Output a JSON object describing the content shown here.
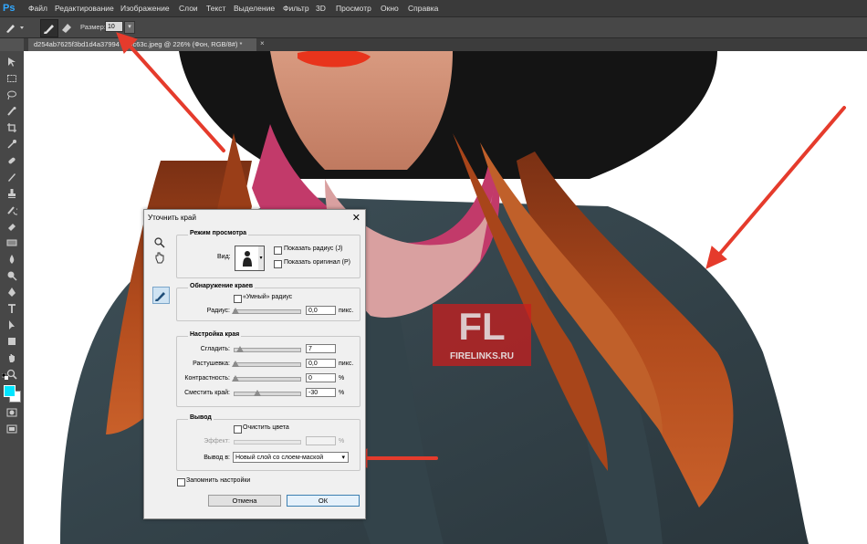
{
  "app": {
    "logo": "Ps"
  },
  "menu": [
    "Файл",
    "Редактирование",
    "Изображение",
    "Слои",
    "Текст",
    "Выделение",
    "Фильтр",
    "3D",
    "Просмотр",
    "Окно",
    "Справка"
  ],
  "options": {
    "size_label": "Размер:",
    "size_value": "10"
  },
  "document": {
    "tab_title": "d254ab7625f3bd1d4a37994 ... oc63c.jpeg @ 226% (Фон, RGB/8#) *"
  },
  "watermark": {
    "logo_text": "FL",
    "site": "FIRELINKS.RU"
  },
  "dialog": {
    "title": "Уточнить край",
    "view_mode": {
      "title": "Режим просмотра",
      "view_label": "Вид:",
      "show_radius": "Показать радиус (J)",
      "show_original": "Показать оригинал (P)"
    },
    "edge_detection": {
      "title": "Обнаружение краев",
      "smart_radius": "«Умный» радиус",
      "radius_label": "Радиус:",
      "radius_value": "0,0",
      "radius_unit": "пикс."
    },
    "adjust_edge": {
      "title": "Настройка края",
      "smooth_label": "Сгладить:",
      "smooth_value": "7",
      "feather_label": "Растушевка:",
      "feather_value": "0,0",
      "feather_unit": "пикс.",
      "contrast_label": "Контрастность:",
      "contrast_value": "0",
      "contrast_unit": "%",
      "shift_label": "Сместить край:",
      "shift_value": "-30",
      "shift_unit": "%"
    },
    "output": {
      "title": "Вывод",
      "decontaminate": "Очистить цвета",
      "effect_label": "Эффект:",
      "effect_unit": "%",
      "output_to_label": "Вывод в:",
      "output_to_value": "Новый слой со слоем-маской"
    },
    "remember": "Запомнить настройки",
    "cancel": "Отмена",
    "ok": "ОК"
  },
  "colors": {
    "accent": "#31a8ff",
    "arrow": "#e53b2c",
    "foreground": "#00e5ff"
  }
}
